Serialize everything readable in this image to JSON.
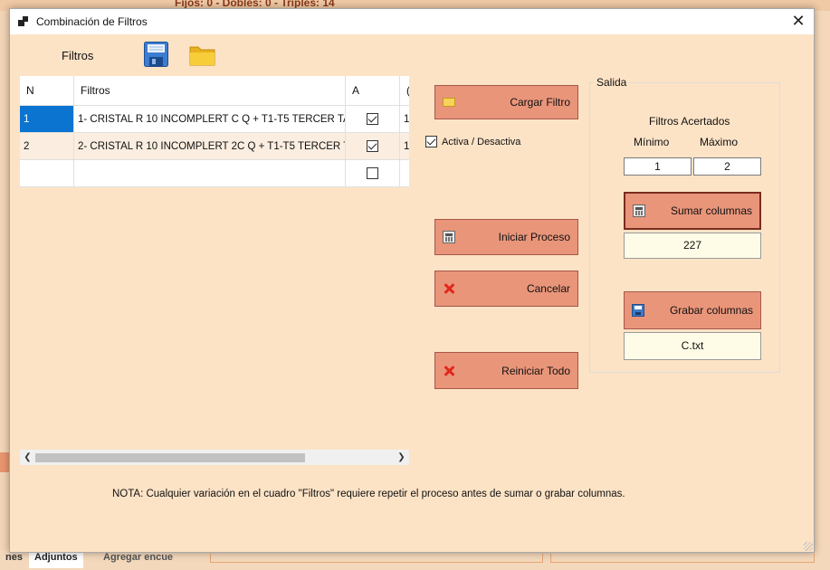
{
  "background": {
    "top_text": "Fijos: 0 - Dobles: 0 - Triples: 14",
    "tabs": [
      "nes",
      "Adjuntos",
      "Agregar encue"
    ]
  },
  "dialog": {
    "title": "Combinación de Filtros",
    "close_label": "✕"
  },
  "toolbar": {
    "filtros_label": "Filtros",
    "save_icon": "floppy-disk-icon",
    "open_icon": "folder-icon"
  },
  "grid": {
    "columns": [
      "N",
      "Filtros",
      "A",
      "("
    ],
    "rows": [
      {
        "n": "1",
        "filtro": "1- CRISTAL R 10 INCOMPLERT C Q + T1-T5 TERCER TA...",
        "a": true,
        "extra": "1",
        "selected": true
      },
      {
        "n": "2",
        "filtro": "2- CRISTAL R 10 INCOMPLERT 2C Q + T1-T5 TERCER T...",
        "a": true,
        "extra": "1",
        "selected": false
      },
      {
        "n": "",
        "filtro": "",
        "a": false,
        "extra": "",
        "selected": false
      }
    ]
  },
  "buttons": {
    "cargar_filtro": "Cargar Filtro",
    "iniciar_proceso": "Iniciar Proceso",
    "cancelar": "Cancelar",
    "reiniciar_todo": "Reiniciar Todo",
    "sumar_columnas": "Sumar columnas",
    "grabar_columnas": "Grabar columnas"
  },
  "activa_label": "Activa / Desactiva",
  "activa_checked": true,
  "salida": {
    "title": "Salida",
    "filtros_acertados": "Filtros Acertados",
    "minimo_label": "Mínimo",
    "maximo_label": "Máximo",
    "minimo_value": "1",
    "maximo_value": "2",
    "sumar_result": "227",
    "grabar_result": "C.txt"
  },
  "nota": "NOTA: Cualquier variación en el cuadro \"Filtros\" requiere repetir el proceso antes de sumar o grabar columnas.",
  "colors": {
    "dialog_bg": "#fde3c6",
    "button_bg": "#e9957a",
    "selection": "#0b74d1",
    "output_bg": "#fefce6"
  }
}
